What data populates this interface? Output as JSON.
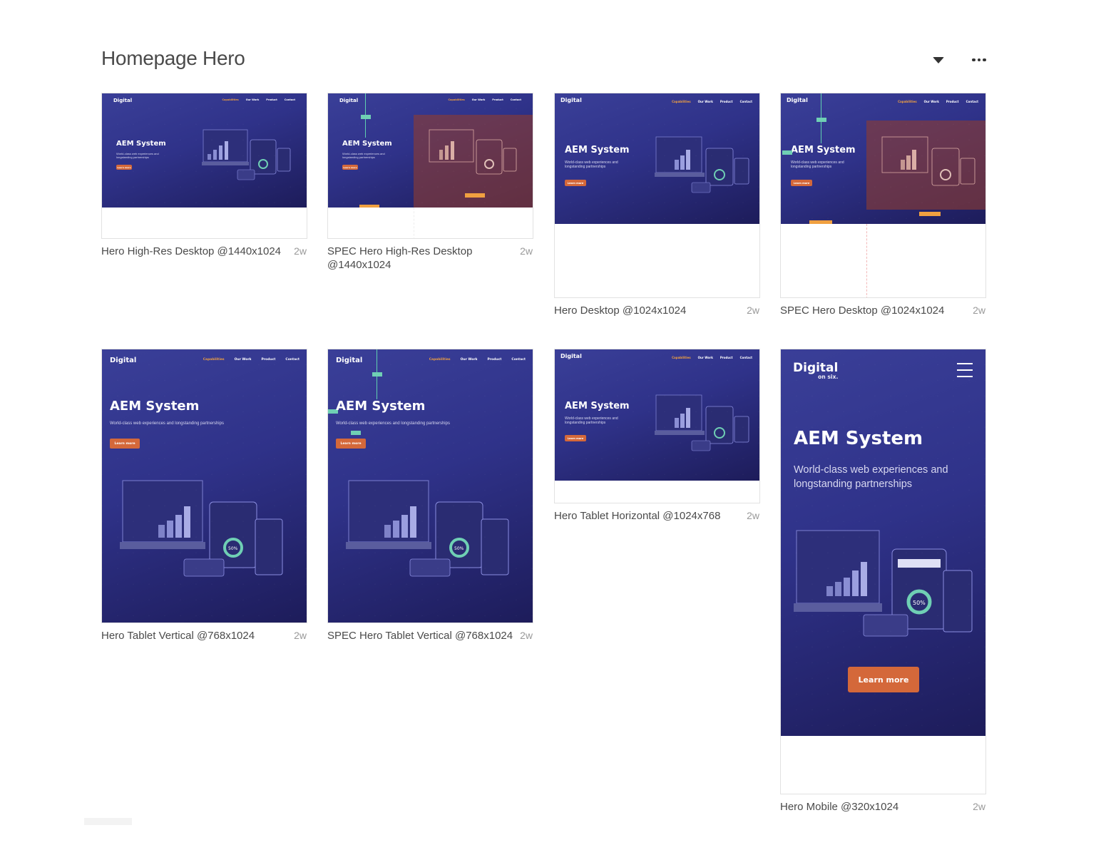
{
  "section": {
    "title": "Homepage Hero"
  },
  "hero": {
    "logo": "Digital",
    "logo_sub": "on six.",
    "title": "AEM System",
    "subtitle": "World-class web experiences and longstanding partnerships",
    "cta": "Learn more",
    "nav": [
      "Capabilities",
      "Our Work",
      "Product",
      "Contact"
    ],
    "gauge": "50%"
  },
  "artboards": [
    {
      "name": "Hero High-Res Desktop @1440x1024",
      "age": "2w"
    },
    {
      "name": "SPEC Hero High-Res Desktop @1440x1024",
      "age": "2w"
    },
    {
      "name": "Hero Desktop @1024x1024",
      "age": "2w"
    },
    {
      "name": "SPEC Hero Desktop @1024x1024",
      "age": "2w"
    },
    {
      "name": "Hero Tablet Vertical @768x1024",
      "age": "2w"
    },
    {
      "name": "SPEC Hero Tablet Vertical @768x1024",
      "age": "2w"
    },
    {
      "name": "Hero Tablet Horizontal @1024x768",
      "age": "2w"
    },
    {
      "name": "Hero Mobile @320x1024",
      "age": "2w"
    }
  ],
  "colors": {
    "hero_bg": "#2f3289",
    "accent": "#d4683a",
    "nav_active": "#f0a040",
    "spec": "#6fcfb4"
  },
  "icons": [
    "caret-down-icon",
    "more-options-icon",
    "menu-icon"
  ]
}
